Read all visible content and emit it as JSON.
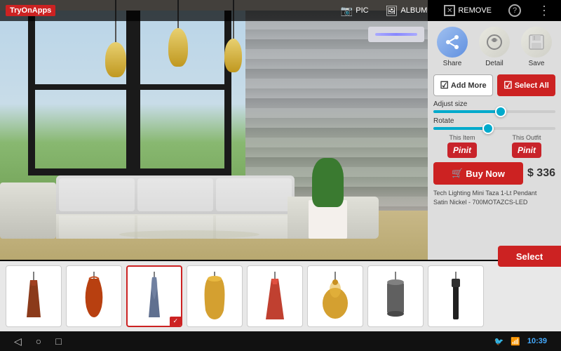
{
  "app": {
    "brand": "TryOnApps"
  },
  "toolbar": {
    "pic_label": "PIC",
    "album_label": "ALBUM",
    "remove_label": "REMOVE"
  },
  "panel": {
    "share_label": "Share",
    "detail_label": "Detail",
    "save_label": "Save",
    "add_more_label": "Add More",
    "select_all_label": "Select All",
    "adjust_size_label": "Adjust size",
    "rotate_label": "Rotate",
    "this_item_label": "This Item",
    "this_outfit_label": "This Outfit",
    "pinit_label": "Pinit",
    "buy_now_label": "Buy Now",
    "price": "$ 336",
    "product_name": "Tech Lighting Mini Taza 1-Lt Pendant",
    "product_sku": "Satin Nickel - 700MOTAZCS-LED"
  },
  "bottom_items": [
    {
      "id": 1,
      "color": "#8B3A1A",
      "shape": "narrow",
      "selected": false
    },
    {
      "id": 2,
      "color": "#B84010",
      "shape": "wavy",
      "selected": false
    },
    {
      "id": 3,
      "color": "#607090",
      "shape": "tall-narrow",
      "selected": true
    },
    {
      "id": 4,
      "color": "#D4A030",
      "shape": "wide",
      "selected": false
    },
    {
      "id": 5,
      "color": "#C04030",
      "shape": "cone",
      "selected": false
    },
    {
      "id": 6,
      "color": "#D4A030",
      "shape": "pendant-round",
      "selected": false
    },
    {
      "id": 7,
      "color": "#606060",
      "shape": "cylinder",
      "selected": false
    },
    {
      "id": 8,
      "color": "#202020",
      "shape": "slim",
      "selected": false
    }
  ],
  "status_bar": {
    "time": "10:39"
  }
}
